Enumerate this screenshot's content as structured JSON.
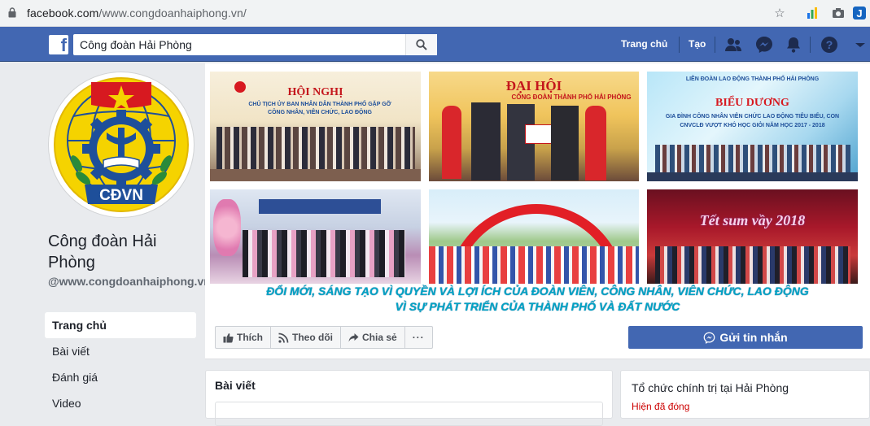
{
  "browser": {
    "url_host": "facebook.com",
    "url_path": "/www.congdoanhaiphong.vn/"
  },
  "topbar": {
    "search_value": "Công đoàn Hải Phòng",
    "nav_home": "Trang chủ",
    "nav_create": "Tạo"
  },
  "page": {
    "name": "Công đoàn Hải Phòng",
    "handle": "@www.congdoanhaiphong.vn",
    "avatar_text": "CĐVN"
  },
  "leftnav": {
    "items": [
      "Trang chủ",
      "Bài viết",
      "Đánh giá",
      "Video"
    ]
  },
  "cover": {
    "photo1_title": "HỘI NGHỊ",
    "photo1_sub": "CHỦ TỊCH ỦY BAN NHÂN DÂN THÀNH PHỐ GẶP GỠ CÔNG NHÂN, VIÊN CHỨC, LAO ĐỘNG",
    "photo2_title": "ĐẠI HỘI",
    "photo2_sub": "CÔNG ĐOÀN THÀNH PHỐ HẢI PHÒNG",
    "photo3_header": "LIÊN ĐOÀN LAO ĐỘNG THÀNH PHỐ HẢI PHÒNG",
    "photo3_title": "BIỂU DƯƠNG",
    "photo3_sub": "GIA ĐÌNH CÔNG NHÂN VIÊN CHỨC LAO ĐỘNG TIÊU BIỂU, CON CNVCLĐ VƯỢT KHÓ HỌC GIỎI NĂM HỌC 2017 - 2018",
    "photo6_title": "Tết sum vầy 2018",
    "slogan_line1": "ĐỔI MỚI, SÁNG TẠO VÌ QUYỀN VÀ LỢI ÍCH CỦA ĐOÀN VIÊN, CÔNG NHÂN, VIÊN CHỨC, LAO ĐỘNG",
    "slogan_line2": "VÌ SỰ PHÁT TRIỂN CỦA THÀNH PHỐ VÀ ĐẤT NƯỚC"
  },
  "actions": {
    "like": "Thích",
    "follow": "Theo dõi",
    "share": "Chia sẻ",
    "more": "···",
    "message": "Gửi tin nhắn"
  },
  "posts": {
    "title": "Bài viết"
  },
  "info": {
    "category": "Tổ chức chính trị tại Hải Phòng",
    "status": "Hiện đã đóng"
  },
  "colors": {
    "fb_blue": "#4267b2",
    "slogan": "#00a3c4",
    "status_red": "#cc0000"
  }
}
